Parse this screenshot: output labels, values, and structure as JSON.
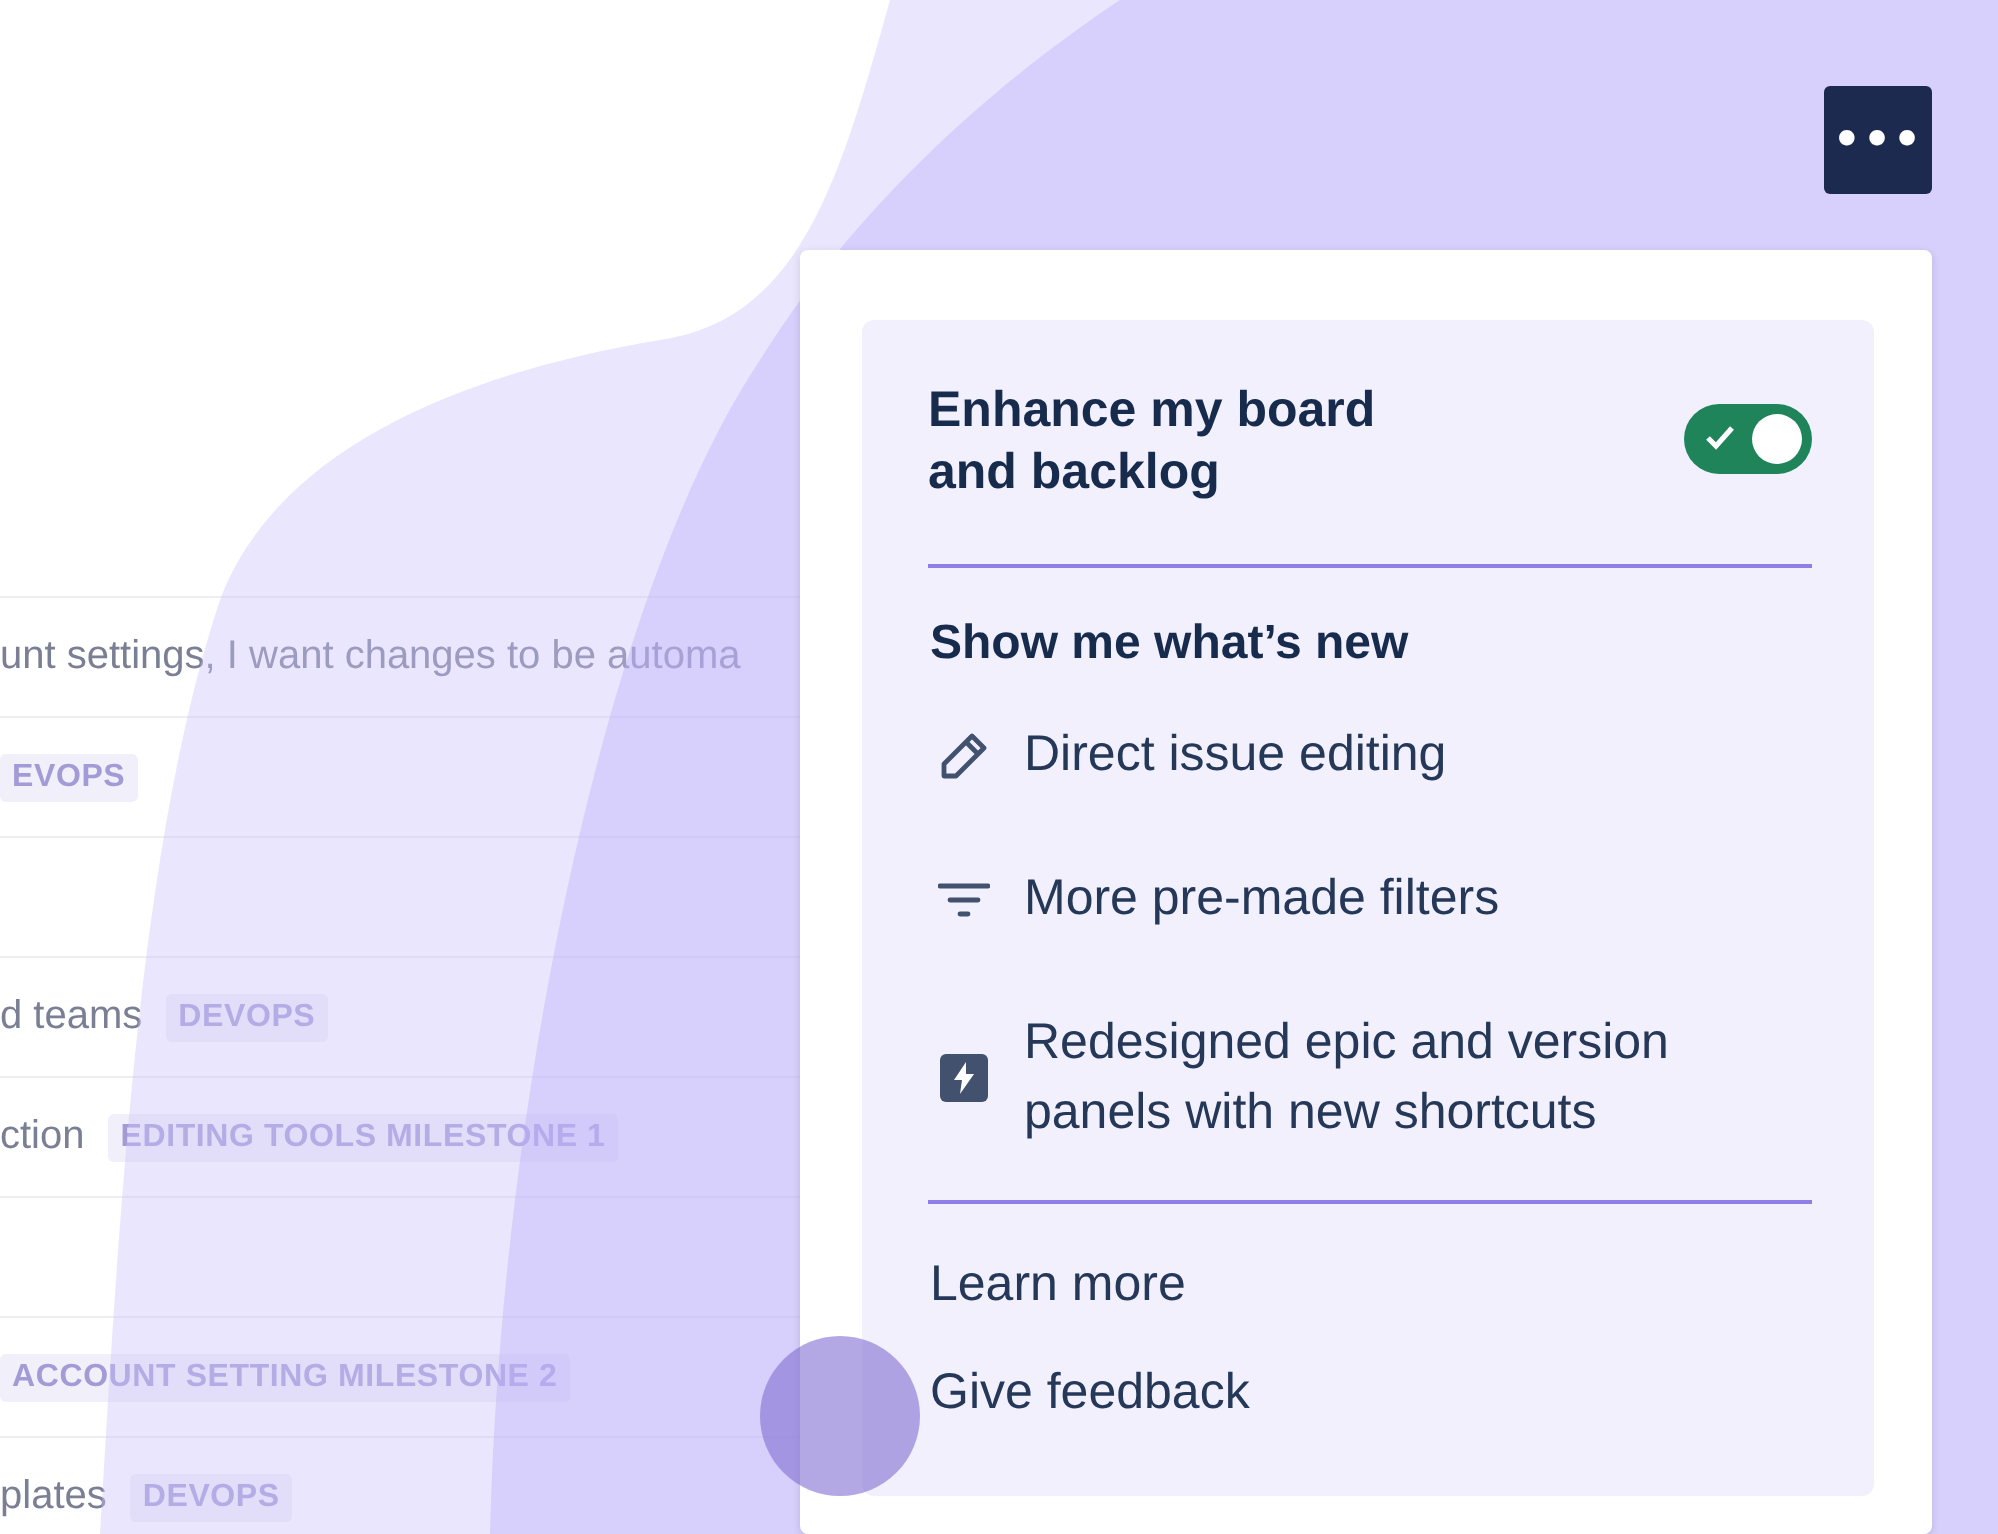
{
  "backlog": {
    "rows": [
      {
        "summary": "unt settings, I want changes to be automa"
      },
      {
        "tag": "EVOPS"
      },
      {},
      {
        "summary": "d teams",
        "tag": "DEVOPS"
      },
      {
        "summary": "ction",
        "tag": "EDITING TOOLS MILESTONE 1"
      },
      {},
      {
        "tag": "ACCOUNT SETTING MILESTONE 2"
      },
      {
        "summary": "plates",
        "tag": "DEVOPS"
      }
    ]
  },
  "more_button": {
    "label": "•••"
  },
  "popup": {
    "title": "Enhance my board and backlog",
    "toggle": {
      "on": true
    },
    "section_title": "Show me what’s new",
    "features": [
      {
        "kind": "edit",
        "label": "Direct issue editing"
      },
      {
        "kind": "filter",
        "label": "More pre-made filters"
      },
      {
        "kind": "bolt",
        "label": "Redesigned epic and version panels with new shortcuts"
      }
    ],
    "links": [
      "Learn more",
      "Give feedback"
    ]
  }
}
